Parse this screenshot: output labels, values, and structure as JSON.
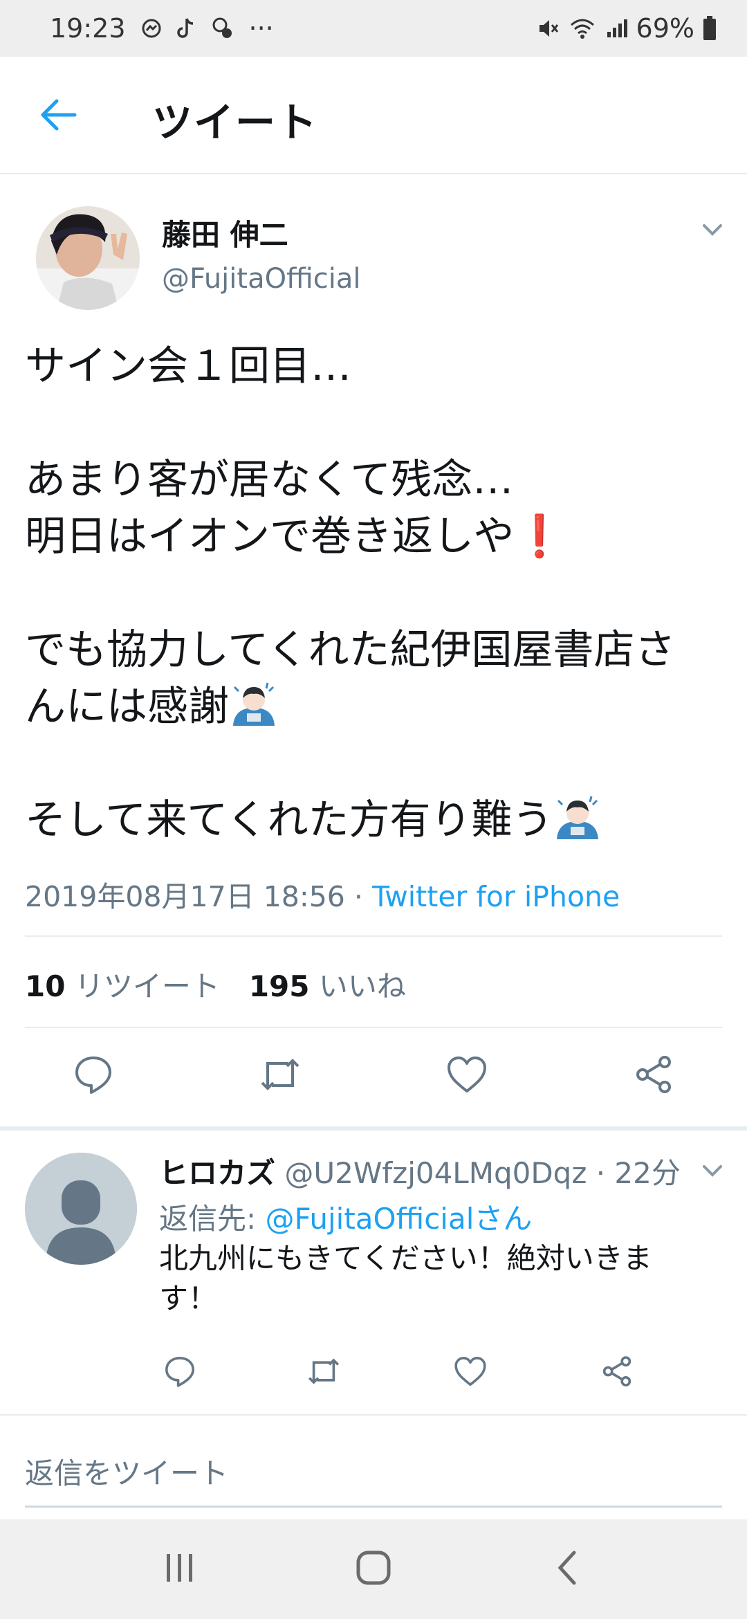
{
  "status_bar": {
    "time": "19:23",
    "overflow": "···",
    "battery": "69%",
    "icons": [
      "messenger-icon",
      "tiktok-icon",
      "vpn-icon",
      "mute-icon",
      "wifi-icon",
      "signal-icon",
      "battery-icon"
    ]
  },
  "header": {
    "title": "ツイート",
    "back_icon": "back-arrow-icon"
  },
  "tweet": {
    "author_name": "藤田 伸二",
    "author_handle": "@FujitaOfficial",
    "lines": [
      "サイン会１回目…",
      "",
      "あまり客が居なくて残念…",
      "明日はイオンで巻き返しや",
      "",
      "でも協力してくれた紀伊国屋書店さ",
      "んには感謝",
      "",
      "そして来てくれた方有り難う"
    ],
    "emoji_exclamation": "❗",
    "timestamp": "2019年08月17日 18:56 · ",
    "source": "Twitter for iPhone",
    "retweet_count": "10",
    "retweet_label": "リツイート",
    "like_count": "195",
    "like_label": "いいね"
  },
  "reply": {
    "name": "ヒロカズ",
    "handle_time": " @U2Wfzj04LMq0Dqz · 22分",
    "reply_to_label": "返信先: ",
    "reply_to_mention": "@FujitaOfficialさん",
    "text": "北九州にもきてください！絶対いきます！"
  },
  "compose": {
    "placeholder": "返信をツイート"
  },
  "colors": {
    "accent": "#1da1f2",
    "secondary_text": "#657786",
    "divider": "#e6ecf0"
  }
}
